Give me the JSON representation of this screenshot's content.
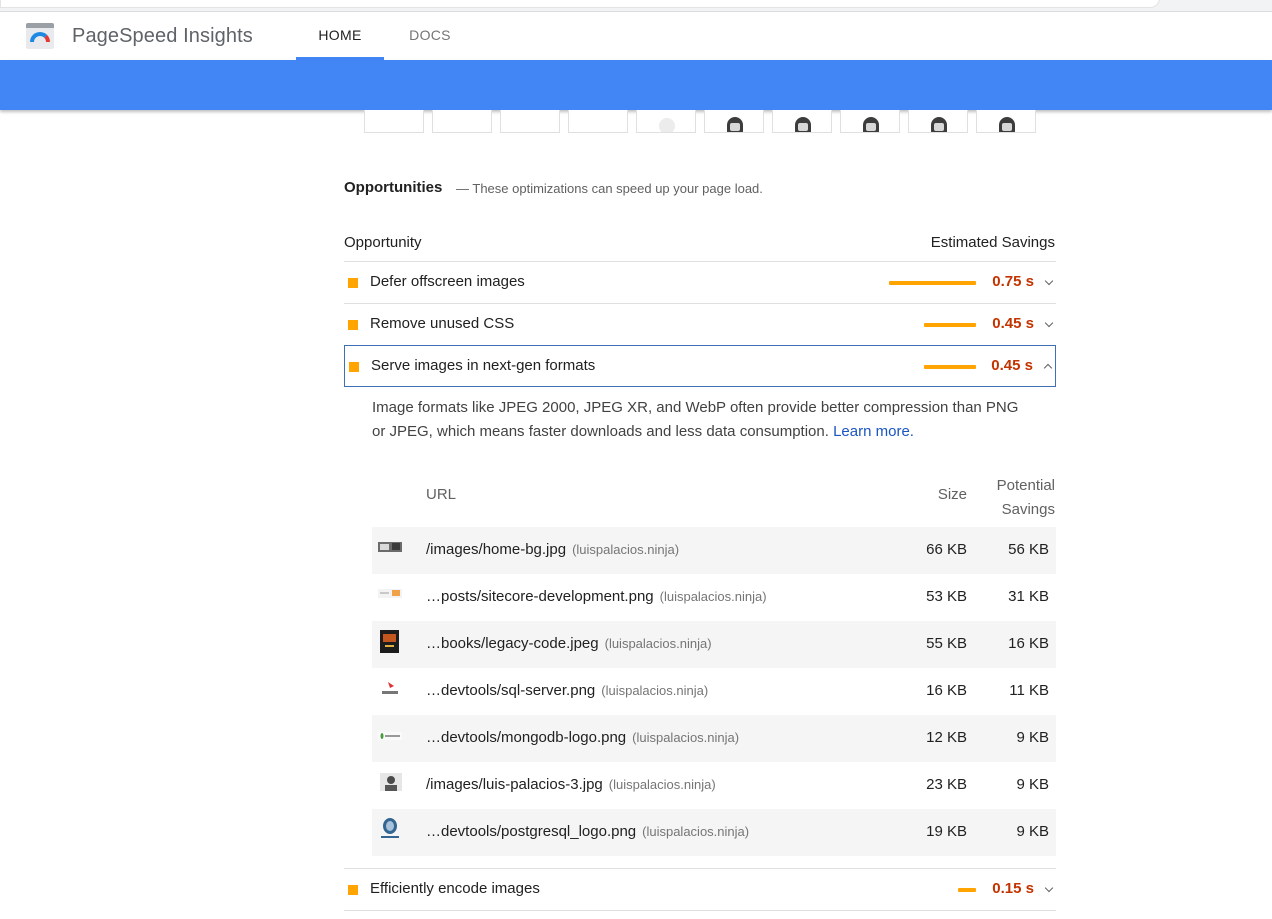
{
  "header": {
    "brand": "PageSpeed Insights",
    "tabs": [
      {
        "label": "HOME",
        "active": true
      },
      {
        "label": "DOCS",
        "active": false
      }
    ],
    "accent_color": "#4285f4"
  },
  "opportunities": {
    "title": "Opportunities",
    "description": "— These optimizations can speed up your page load.",
    "col_opportunity": "Opportunity",
    "col_savings": "Estimated Savings",
    "audits": [
      {
        "title": "Defer offscreen images",
        "savings": "0.75 s",
        "bar_fraction": 1.0,
        "expanded": false
      },
      {
        "title": "Remove unused CSS",
        "savings": "0.45 s",
        "bar_fraction": 0.6,
        "expanded": false
      },
      {
        "title": "Serve images in next-gen formats",
        "savings": "0.45 s",
        "bar_fraction": 0.6,
        "expanded": true
      },
      {
        "title": "Efficiently encode images",
        "savings": "0.15 s",
        "bar_fraction": 0.2,
        "expanded": false
      }
    ],
    "status_color": "#ffa400",
    "value_color": "#c33300"
  },
  "detail": {
    "description": "Image formats like JPEG 2000, JPEG XR, and WebP often provide better compression than PNG or JPEG, which means faster downloads and less data consumption.",
    "learn_more": "Learn more.",
    "col_url": "URL",
    "col_size": "Size",
    "col_savings_1": "Potential",
    "col_savings_2": "Savings",
    "rows": [
      {
        "url": "/images/home-bg.jpg",
        "host": "(luispalacios.ninja)",
        "size": "66 KB",
        "savings": "56 KB",
        "thumb": "photo-thumb"
      },
      {
        "url": "…posts/sitecore-development.png",
        "host": "(luispalacios.ninja)",
        "size": "53 KB",
        "savings": "31 KB",
        "thumb": "banner-thumb"
      },
      {
        "url": "…books/legacy-code.jpeg",
        "host": "(luispalacios.ninja)",
        "size": "55 KB",
        "savings": "16 KB",
        "thumb": "book-thumb"
      },
      {
        "url": "…devtools/sql-server.png",
        "host": "(luispalacios.ninja)",
        "size": "16 KB",
        "savings": "11 KB",
        "thumb": "sql-thumb"
      },
      {
        "url": "…devtools/mongodb-logo.png",
        "host": "(luispalacios.ninja)",
        "size": "12 KB",
        "savings": "9 KB",
        "thumb": "mongo-thumb"
      },
      {
        "url": "/images/luis-palacios-3.jpg",
        "host": "(luispalacios.ninja)",
        "size": "23 KB",
        "savings": "9 KB",
        "thumb": "portrait-thumb"
      },
      {
        "url": "…devtools/postgresql_logo.png",
        "host": "(luispalacios.ninja)",
        "size": "19 KB",
        "savings": "9 KB",
        "thumb": "postgres-thumb"
      }
    ]
  }
}
